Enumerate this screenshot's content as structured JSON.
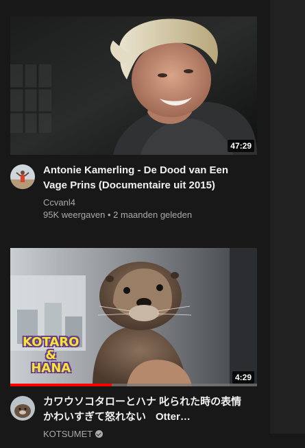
{
  "videos": [
    {
      "title": "Antonie Kamerling - De Dood van Een Vage Prins (Documentaire uit 2015)",
      "channel": "Ccvanl4",
      "views": "95K weergaven",
      "separator": "•",
      "age": "2 maanden geleden",
      "duration": "47:29",
      "thumbnail_icon": "portrait-man-blond-hair-thumbnail",
      "avatar_icon": "channel-avatar-figure"
    },
    {
      "title": "カワウソコタローとハナ 叱られた時の表情かわいすぎて怒れない",
      "title_suffix": "Otter…",
      "channel": "KOTSUMET",
      "verified": true,
      "duration": "4:29",
      "progress_percent": 41,
      "overlay_text_line1": "KOTARO",
      "overlay_text_line2": "&",
      "overlay_text_line3": "HANA",
      "thumbnail_icon": "otter-thumbnail",
      "avatar_icon": "otter-avatar"
    }
  ],
  "colors": {
    "background": "#181818",
    "text_primary": "#f1f1f1",
    "text_secondary": "#aaaaaa",
    "progress": "#ff0000",
    "overlay_text": "#f7e436"
  }
}
